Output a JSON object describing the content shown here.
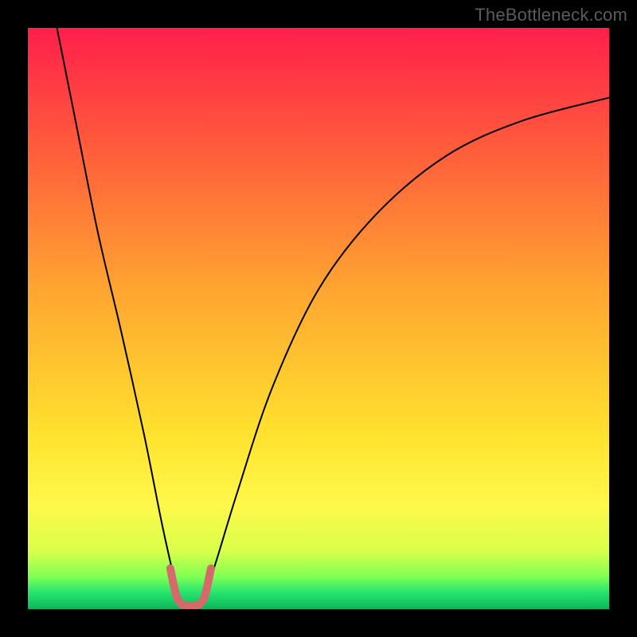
{
  "watermark": "TheBottleneck.com",
  "chart_data": {
    "type": "line",
    "title": "",
    "xlabel": "",
    "ylabel": "",
    "xlim": [
      0,
      100
    ],
    "ylim": [
      0,
      100
    ],
    "gradient_stops": [
      {
        "offset": 0,
        "color": "#ff1f4b"
      },
      {
        "offset": 0.2,
        "color": "#ff5a3c"
      },
      {
        "offset": 0.45,
        "color": "#ffa531"
      },
      {
        "offset": 0.7,
        "color": "#ffe22e"
      },
      {
        "offset": 0.82,
        "color": "#fff84a"
      },
      {
        "offset": 0.9,
        "color": "#d9ff4a"
      },
      {
        "offset": 0.945,
        "color": "#7fff55"
      },
      {
        "offset": 0.97,
        "color": "#28e66f"
      },
      {
        "offset": 1.0,
        "color": "#0cb65a"
      }
    ],
    "series": [
      {
        "name": "bottleneck-curve",
        "color": "#000000",
        "width": 2,
        "points": [
          {
            "x": 5,
            "y": 100
          },
          {
            "x": 8,
            "y": 85
          },
          {
            "x": 12,
            "y": 65
          },
          {
            "x": 16,
            "y": 48
          },
          {
            "x": 20,
            "y": 30
          },
          {
            "x": 23,
            "y": 15
          },
          {
            "x": 25,
            "y": 6
          },
          {
            "x": 26,
            "y": 2
          },
          {
            "x": 27,
            "y": 0.5
          },
          {
            "x": 29,
            "y": 0.5
          },
          {
            "x": 30,
            "y": 2
          },
          {
            "x": 32,
            "y": 7
          },
          {
            "x": 36,
            "y": 20
          },
          {
            "x": 42,
            "y": 38
          },
          {
            "x": 50,
            "y": 55
          },
          {
            "x": 60,
            "y": 68
          },
          {
            "x": 72,
            "y": 78
          },
          {
            "x": 85,
            "y": 84
          },
          {
            "x": 100,
            "y": 88
          }
        ]
      },
      {
        "name": "valley-marker",
        "color": "#d46a6a",
        "width": 10,
        "points": [
          {
            "x": 24.5,
            "y": 7
          },
          {
            "x": 25.5,
            "y": 2.5
          },
          {
            "x": 26.5,
            "y": 0.8
          },
          {
            "x": 28.0,
            "y": 0.5
          },
          {
            "x": 29.5,
            "y": 0.8
          },
          {
            "x": 30.5,
            "y": 2.5
          },
          {
            "x": 31.5,
            "y": 7
          }
        ]
      }
    ]
  }
}
